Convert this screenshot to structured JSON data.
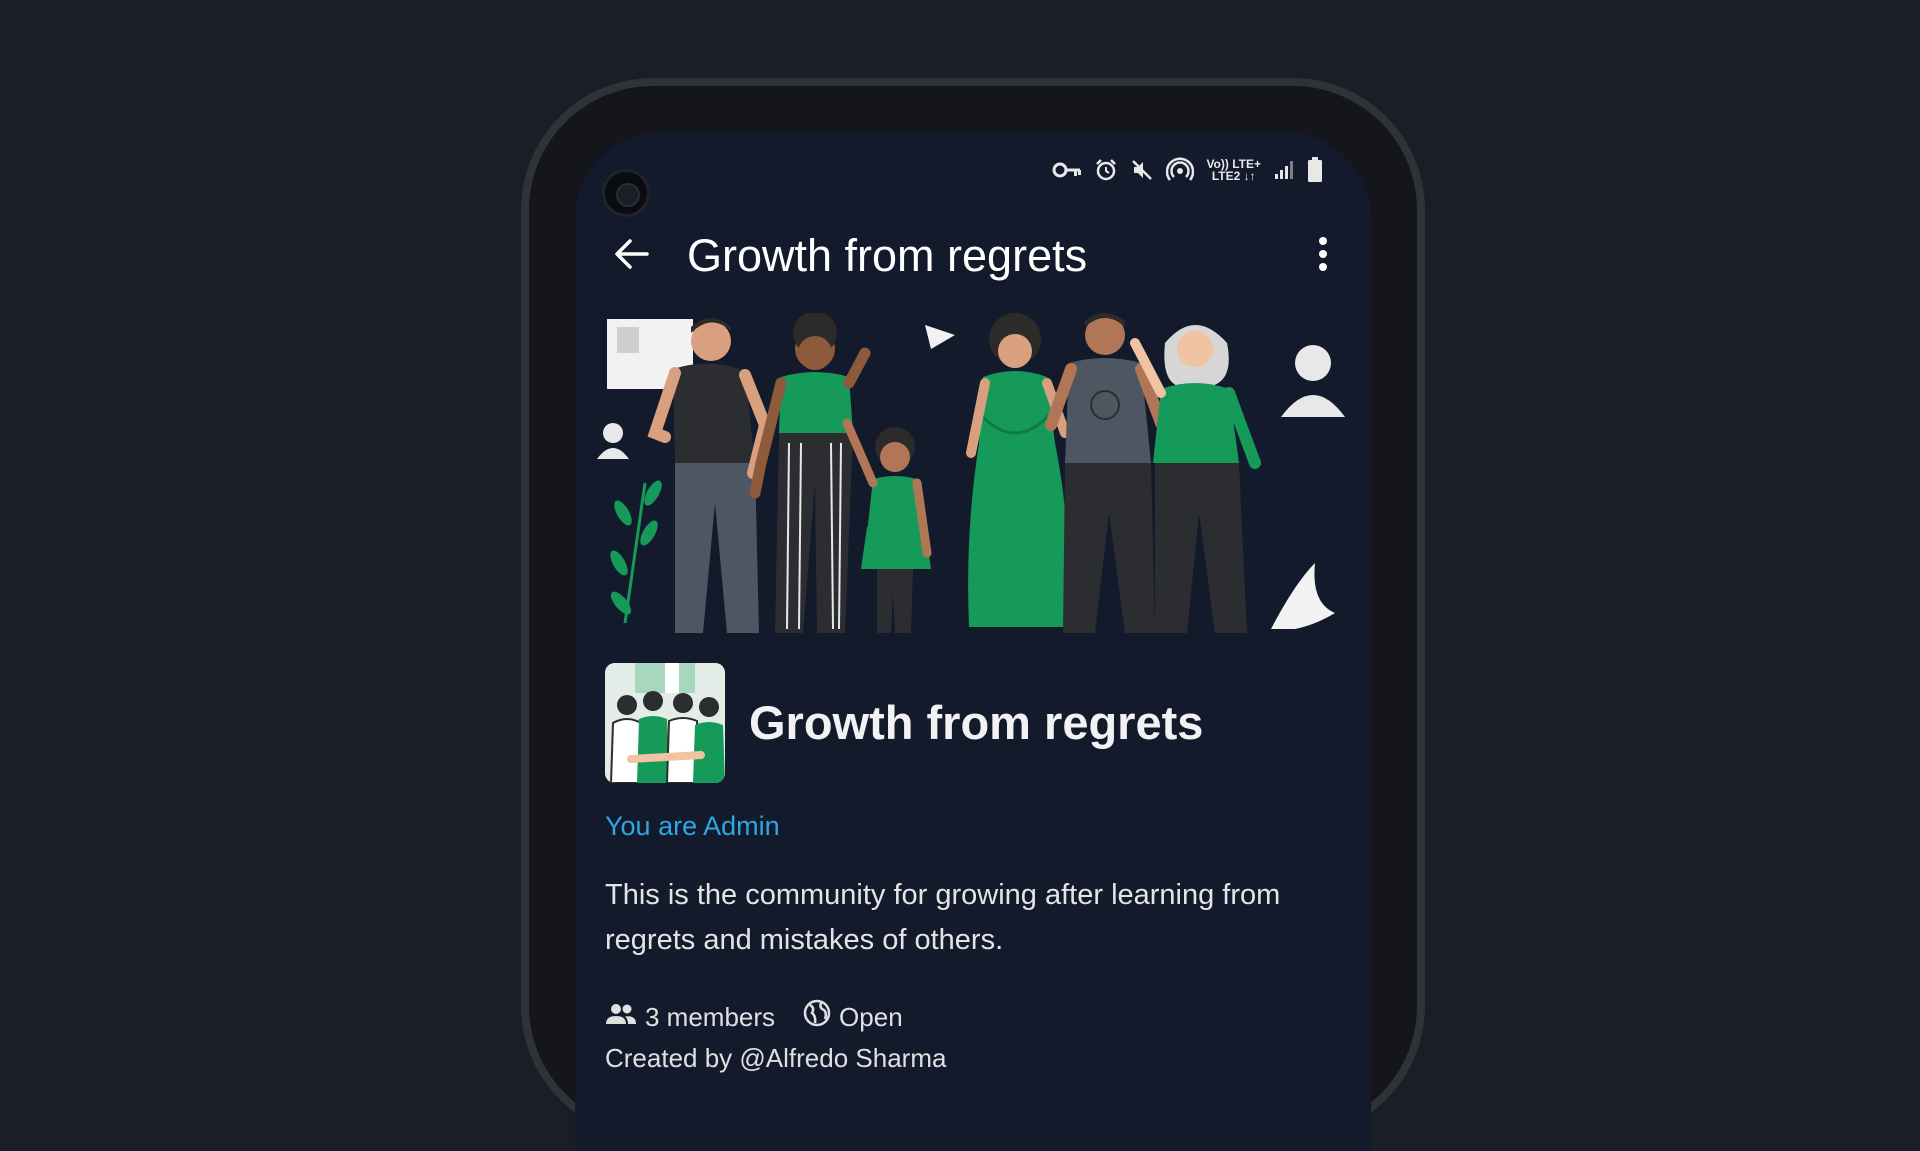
{
  "status_bar": {
    "icons": [
      "vpn-key-icon",
      "alarm-icon",
      "mute-icon",
      "hotspot-icon",
      "volte-icon",
      "signal-icon",
      "battery-icon"
    ],
    "volte_line1": "Vo)) LTE+",
    "volte_line2": "LTE2 ↓↑"
  },
  "app_bar": {
    "title": "Growth from regrets",
    "back_icon": "arrow-back-icon",
    "menu_icon": "more-vert-icon"
  },
  "group": {
    "name": "Growth from regrets",
    "role": "You are Admin",
    "description": "This is the community for growing after learning from regrets and mistakes of others.",
    "members": "3 members",
    "visibility": "Open",
    "created_by": "Created by @Alfredo Sharma"
  },
  "colors": {
    "background": "#1a1e27",
    "screen": "#121a2c",
    "accent_blue": "#2fa6e0",
    "illustration_green": "#169a5a"
  }
}
